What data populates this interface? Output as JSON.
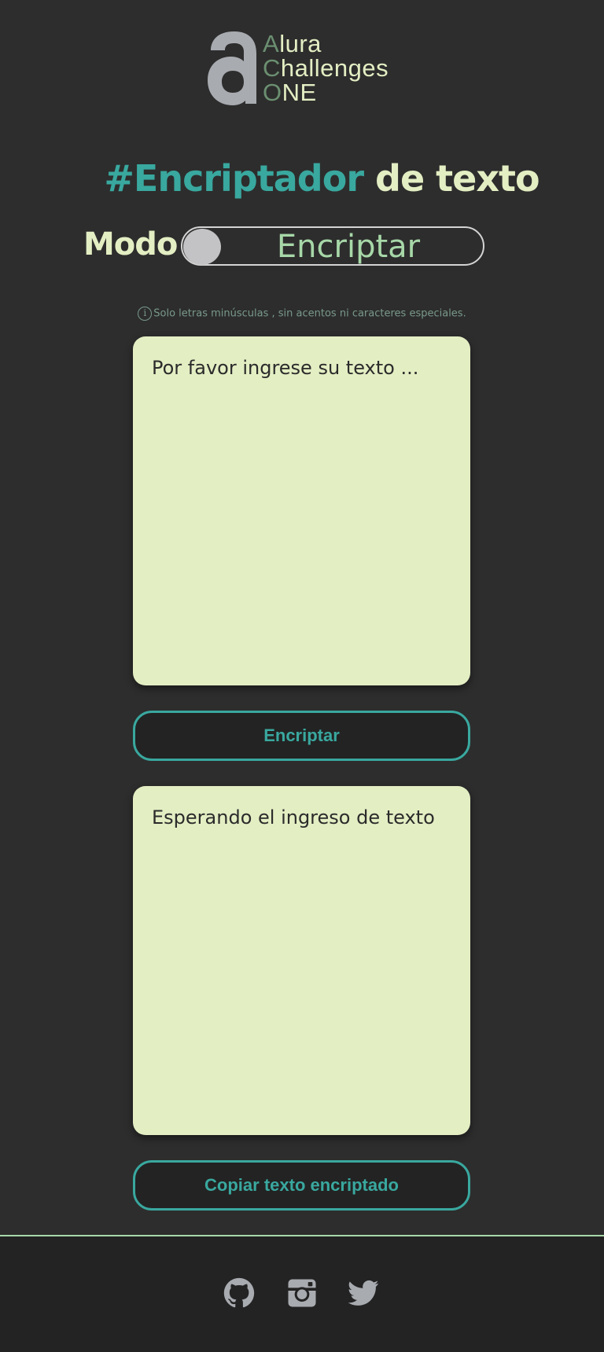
{
  "logo": {
    "lines": [
      {
        "initial": "A",
        "rest": "lura"
      },
      {
        "initial": "C",
        "rest": "hallenges"
      },
      {
        "initial": "O",
        "rest": "NE"
      }
    ]
  },
  "title": {
    "hashtag": "#Encriptador",
    "rest": "de texto"
  },
  "mode": {
    "label": "Modo",
    "toggle_text": "Encriptar"
  },
  "hint": {
    "text": "Solo letras minúsculas , sin acentos ni caracteres especiales."
  },
  "input": {
    "placeholder": "Por favor ingrese su texto ..."
  },
  "encrypt_button": {
    "label": "Encriptar"
  },
  "output": {
    "text": "Esperando el ingreso de texto"
  },
  "copy_button": {
    "label": "Copiar texto encriptado"
  },
  "footer": {
    "icons": [
      "github-icon",
      "instagram-icon",
      "twitter-icon"
    ]
  },
  "colors": {
    "background": "#2d2d2d",
    "accent": "#39a89f",
    "cream": "#e3eec3",
    "mint": "#a7d8a8",
    "footer": "#232323"
  }
}
